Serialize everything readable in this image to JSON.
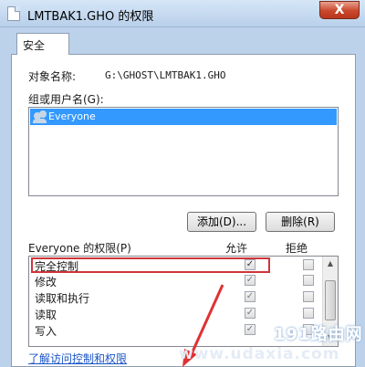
{
  "window": {
    "title": "LMTBAK1.GHO 的权限",
    "close_label": "X"
  },
  "tabs": [
    {
      "label": "安全"
    }
  ],
  "object": {
    "label": "对象名称:",
    "value": "G:\\GHOST\\LMTBAK1.GHO"
  },
  "groups": {
    "label": "组或用户名(G):",
    "items": [
      {
        "name": "Everyone",
        "selected": true
      }
    ]
  },
  "buttons": {
    "add_label": "添加(D)...",
    "remove_label": "删除(R)"
  },
  "permissions": {
    "header_label": "Everyone 的权限(P)",
    "allow_header": "允许",
    "deny_header": "拒绝",
    "rows": [
      {
        "name": "完全控制",
        "allow": "✓",
        "deny": ""
      },
      {
        "name": "修改",
        "allow": "✓",
        "deny": ""
      },
      {
        "name": "读取和执行",
        "allow": "✓",
        "deny": ""
      },
      {
        "name": "读取",
        "allow": "✓",
        "deny": ""
      },
      {
        "name": "写入",
        "allow": "✓",
        "deny": ""
      }
    ]
  },
  "link": {
    "label": "了解访问控制和权限"
  },
  "watermark": {
    "logo": "191路由网",
    "url": "www.udaxia.com"
  },
  "colors": {
    "selection": "#3399ff",
    "highlight_border": "#d0343a",
    "link": "#1a55c8"
  },
  "icons": {
    "window": "document-icon",
    "user": "users-icon"
  }
}
